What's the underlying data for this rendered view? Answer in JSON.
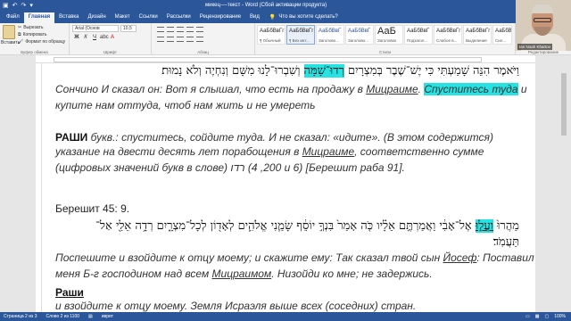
{
  "window": {
    "title": "микец----текст - Word (Сбой активации продукта)",
    "quick_access": [
      "save-icon",
      "undo-icon",
      "redo-icon",
      "customize-icon"
    ]
  },
  "ribbon": {
    "tabs": [
      "Файл",
      "Главная",
      "Вставка",
      "Дизайн",
      "Макет",
      "Ссылки",
      "Рассылки",
      "Рецензирование",
      "Вид"
    ],
    "active_tab": "Главная",
    "tell_me": "Что вы хотите сделать?",
    "clipboard": {
      "paste": "Вставить",
      "cut": "Вырезать",
      "copy": "Копировать",
      "format_painter": "Формат по образцу",
      "group_label": "Буфер обмена"
    },
    "font": {
      "name": "Arial (Основ",
      "size": "10,5",
      "group_label": "Шрифт"
    },
    "paragraph": {
      "group_label": "Абзац"
    },
    "styles": {
      "group_label": "Стили",
      "items": [
        {
          "preview": "АаБбВвГг",
          "name": "¶ Обычный",
          "style": "normal",
          "selected": false
        },
        {
          "preview": "АаБбВвГг",
          "name": "¶ Без инт...",
          "style": "normal",
          "selected": true
        },
        {
          "preview": "АаБбВвГ",
          "name": "Заголово...",
          "style": "blue",
          "selected": false
        },
        {
          "preview": "АаБбВвГ",
          "name": "Заголово...",
          "style": "blue",
          "selected": false
        },
        {
          "preview": "АаБ",
          "name": "Заголовок",
          "style": "big",
          "selected": false
        },
        {
          "preview": "АаБбВвГ",
          "name": "Подзагол...",
          "style": "normal",
          "selected": false
        },
        {
          "preview": "АаБбВвГг",
          "name": "Слабое в...",
          "style": "normal",
          "selected": false
        },
        {
          "preview": "АаБбВвГг",
          "name": "Выделение",
          "style": "normal",
          "selected": false
        },
        {
          "preview": "АаБбВ",
          "name": "Сил...",
          "style": "normal",
          "selected": false
        }
      ]
    },
    "editing": {
      "group_label": "Редактирование"
    }
  },
  "webcam": {
    "name": "Ian Noah Khartov"
  },
  "document": {
    "p1_heb_a": "וַיֹּאמֶר הִנֵּה שָׁמַעְתִּי כִּי יֶשׁ־שֶׁבֶר בְּמִצְרָיִם ",
    "p1_heb_hl": "רְדוּ־שָׁמָּה",
    "p1_heb_b": " וְשִׁבְרוּ־לָנוּ מִשָּׁם וְנִחְיֶה וְלֹא נָמוּת׃",
    "p1_ru_1a": "Сончино И сказал он: Вот я слышал, что есть на продажу в ",
    "p1_ru_1b": "Мицраиме",
    "p1_ru_1c": ". ",
    "p1_ru_1d": "Спуститесь туда",
    "p1_ru_1e": " и",
    "p1_ru_2": "купите нам оттуда, чтоб нам жить и не умереть",
    "rashi_label": "РАШИ",
    "rashi_1": " букв.: спуститесь, сойдите туда. И не сказал: «идите». (В этом содержится)",
    "rashi_2a": "указание на двести десять лет порабощения в ",
    "rashi_2b": "Мицраиме",
    "rashi_2c": ", соответственно сумме",
    "rashi_3": "(цифровых значений букв в слове) רדו (200, 4 и 6) [Берешит раба 91].",
    "ref": "Берешит 45: 9.",
    "p2_heb_1a": "מַהֲרוּ֙ ",
    "p2_heb_1hl": "וַעֲל֣וּ",
    "p2_heb_1b": " אֶל־אָבִ֔י וַאֲמַרְתֶּ֣ם אֵלָ֗יו כֹּ֤ה אָמַר֙ בִּנְךָ֣ יוֹסֵ֔ף שָׂמַ֧נִי אֱלֹהִ֛ים לְאָד֖וֹן לְכָל־מִצְרָ֑יִם רְדָ֥ה אֵלַ֖י אַל־",
    "p2_heb_2": "תַּעֲמֹֽד׃",
    "p2_ru_1a": "Поспешите ",
    "p2_ru_1b": "и взойдите к отцу моему",
    "p2_ru_1c": "; и скажите ему: Так сказал твой сын ",
    "p2_ru_1d": "Йосеф",
    "p2_ru_1e": ": Поставил",
    "p2_ru_2a": "меня Б-г господином над всем ",
    "p2_ru_2b": "Мицраимом",
    "p2_ru_2c": ". Низойди ко мне; не задержись.",
    "rashi2_label": "Раши",
    "rashi2_1": "и взойдите к отцу моему. Земля Исраэля выше всех (соседних) стран."
  },
  "statusbar": {
    "page": "Страница 2 из 3",
    "words": "Слово 2 из 1100",
    "lang": "иврит",
    "zoom": "100%"
  },
  "colors": {
    "accent": "#2b579a",
    "highlight_cyan": "#27e2e2",
    "link_blue": "#2f75b5"
  }
}
